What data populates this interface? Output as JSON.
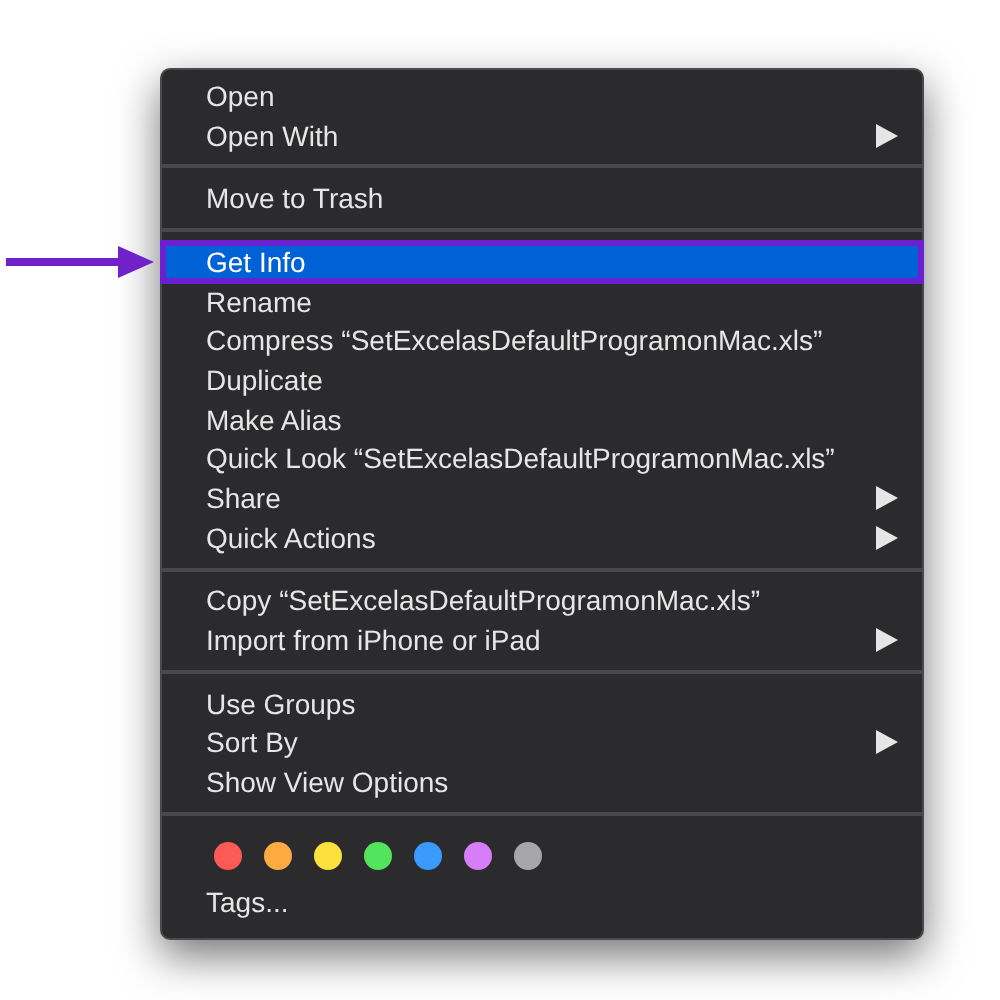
{
  "menu": {
    "sections": [
      {
        "items": [
          {
            "label": "Open",
            "submenu": false,
            "selected": false
          },
          {
            "label": "Open With",
            "submenu": true,
            "selected": false
          }
        ]
      },
      {
        "items": [
          {
            "label": "Move to Trash",
            "submenu": false,
            "selected": false
          }
        ]
      },
      {
        "items": [
          {
            "label": "Get Info",
            "submenu": false,
            "selected": true
          },
          {
            "label": "Rename",
            "submenu": false,
            "selected": false
          },
          {
            "label": "Compress “SetExcelasDefaultProgramonMac.xls”",
            "submenu": false,
            "selected": false
          },
          {
            "label": "Duplicate",
            "submenu": false,
            "selected": false
          },
          {
            "label": "Make Alias",
            "submenu": false,
            "selected": false
          },
          {
            "label": "Quick Look “SetExcelasDefaultProgramonMac.xls”",
            "submenu": false,
            "selected": false
          },
          {
            "label": "Share",
            "submenu": true,
            "selected": false
          },
          {
            "label": "Quick Actions",
            "submenu": true,
            "selected": false
          }
        ]
      },
      {
        "items": [
          {
            "label": "Copy “SetExcelasDefaultProgramonMac.xls”",
            "submenu": false,
            "selected": false
          },
          {
            "label": "Import from iPhone or iPad",
            "submenu": true,
            "selected": false
          }
        ]
      },
      {
        "items": [
          {
            "label": "Use Groups",
            "submenu": false,
            "selected": false
          },
          {
            "label": "Sort By",
            "submenu": true,
            "selected": false
          },
          {
            "label": "Show View Options",
            "submenu": false,
            "selected": false
          }
        ]
      }
    ],
    "tags": {
      "colors": [
        {
          "color": "#fc5a55"
        },
        {
          "color": "#fdab40"
        },
        {
          "color": "#fde03d"
        },
        {
          "color": "#53e35c"
        },
        {
          "color": "#3a9bfc"
        },
        {
          "color": "#d67ef8"
        },
        {
          "color": "#a7a7aa"
        }
      ],
      "label": "Tags..."
    }
  }
}
